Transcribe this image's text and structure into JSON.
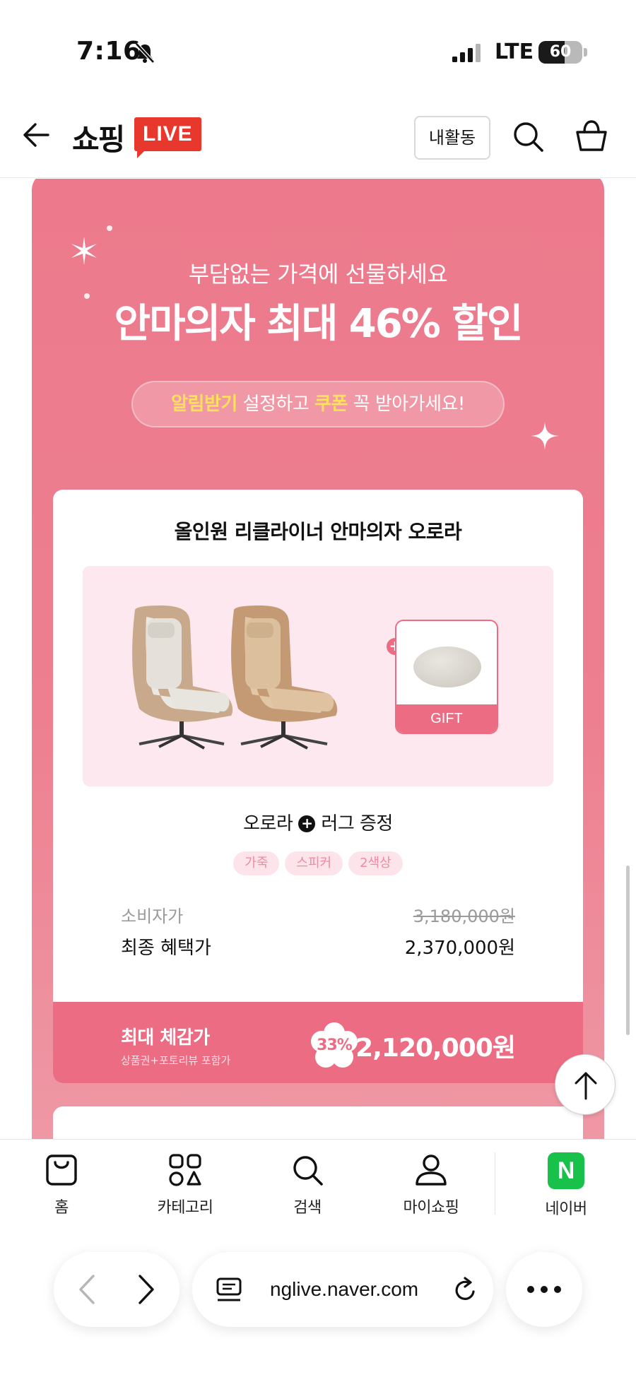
{
  "status_bar": {
    "time": "7:16",
    "network": "LTE",
    "battery": "60",
    "battery_level": 0.6
  },
  "header": {
    "brand_text": "쇼핑",
    "brand_badge": "LIVE",
    "activity_button": "내활동",
    "icons": [
      "back-arrow-icon",
      "search-icon",
      "shopping-bag-icon"
    ]
  },
  "promo": {
    "subtitle": "부담없는 가격에 선물하세요",
    "title": "안마의자 최대 46% 할인",
    "notice": {
      "highlight1": "알림받기",
      "text1": " 설정하고 ",
      "highlight2": "쿠폰",
      "text2": " 꼭 받아가세요!"
    }
  },
  "product": {
    "name": "올인원 리클라이너 안마의자 오로라",
    "gift_label": "GIFT",
    "bundle_left": "오로라",
    "bundle_right": "러그 증정",
    "tags": [
      "가죽",
      "스피커",
      "2색상"
    ],
    "consumer_price_label": "소비자가",
    "consumer_price": "3,180,000원",
    "final_price_label": "최종 혜택가",
    "final_price": "2,370,000원",
    "max_label": "최대 체감가",
    "max_sub": "상품권+포토리뷰 포함가",
    "discount": "33%",
    "max_price": "2,120,000원"
  },
  "bottom_nav": [
    {
      "label": "홈",
      "icon": "home-bag-icon"
    },
    {
      "label": "카테고리",
      "icon": "category-icon"
    },
    {
      "label": "검색",
      "icon": "search-icon"
    },
    {
      "label": "마이쇼핑",
      "icon": "person-icon"
    },
    {
      "label": "네이버",
      "icon": "naver-logo"
    }
  ],
  "naver_logo_letter": "N",
  "browser": {
    "url": "nglive.naver.com"
  },
  "colors": {
    "promo_pink": "#ec7a8c",
    "accent_pink": "#ec6d83",
    "highlight_yellow": "#ffe15a",
    "brand_red": "#e8372c",
    "naver_green": "#18c14a"
  }
}
